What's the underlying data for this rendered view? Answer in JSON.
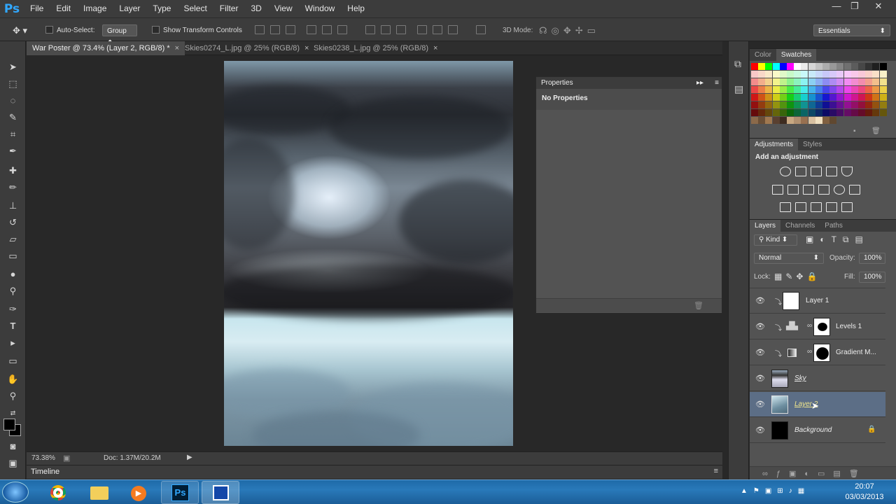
{
  "app": {
    "logo": "Ps"
  },
  "menu": [
    "File",
    "Edit",
    "Image",
    "Layer",
    "Type",
    "Select",
    "Filter",
    "3D",
    "View",
    "Window",
    "Help"
  ],
  "window_controls": {
    "minimize": "—",
    "restore": "❐",
    "close": "✕"
  },
  "options": {
    "auto_select_label": "Auto-Select:",
    "auto_select_value": "Group",
    "show_transform_label": "Show Transform Controls",
    "mode_3d_label": "3D Mode:",
    "workspace": "Essentials"
  },
  "tabs": [
    {
      "label": "War Poster @ 73.4% (Layer 2, RGB/8) *",
      "close": "×"
    },
    {
      "label": "Skies0274_L.jpg @ 25% (RGB/8)",
      "close": "×"
    },
    {
      "label": "Skies0238_L.jpg @ 25% (RGB/8)",
      "close": "×"
    }
  ],
  "status": {
    "zoom": "73.38%",
    "doc": "Doc: 1.37M/20.2M"
  },
  "timeline": {
    "label": "Timeline"
  },
  "properties": {
    "title": "Properties",
    "empty": "No Properties"
  },
  "color_panel": {
    "tabs": [
      "Color",
      "Swatches"
    ]
  },
  "adjustments": {
    "tabs": [
      "Adjustments",
      "Styles"
    ],
    "heading": "Add an adjustment"
  },
  "layers_panel": {
    "tabs": [
      "Layers",
      "Channels",
      "Paths"
    ],
    "kind": "Kind",
    "blend": "Normal",
    "opacity_label": "Opacity:",
    "opacity": "100%",
    "lock_label": "Lock:",
    "fill_label": "Fill:",
    "fill": "100%",
    "layers": [
      {
        "name": "Layer 1",
        "selected": false
      },
      {
        "name": "Levels 1",
        "selected": false
      },
      {
        "name": "Gradient M...",
        "selected": false
      },
      {
        "name": "Sky",
        "selected": false
      },
      {
        "name": "Layer 2",
        "selected": true
      },
      {
        "name": "Background",
        "selected": false
      }
    ]
  },
  "taskbar": {
    "time": "20:07",
    "date": "03/03/2013",
    "ps_button": "Ps"
  }
}
